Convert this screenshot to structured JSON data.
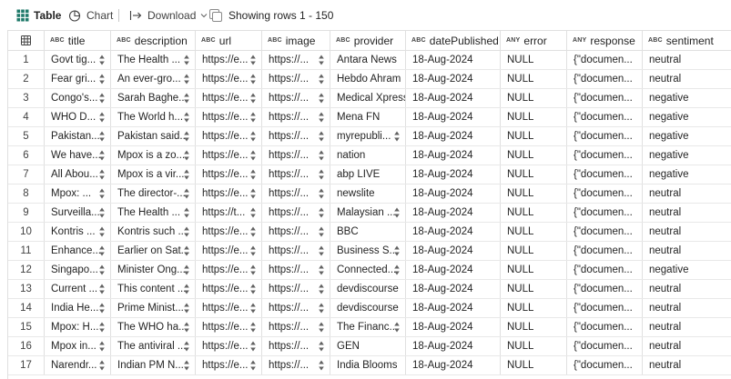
{
  "toolbar": {
    "table_label": "Table",
    "chart_label": "Chart",
    "download_label": "Download",
    "rows_label": "Showing rows 1 - 150"
  },
  "columns": [
    {
      "type": "ABC",
      "name": "title"
    },
    {
      "type": "ABC",
      "name": "description"
    },
    {
      "type": "ABC",
      "name": "url"
    },
    {
      "type": "ABC",
      "name": "image"
    },
    {
      "type": "ABC",
      "name": "provider"
    },
    {
      "type": "ABC",
      "name": "datePublished"
    },
    {
      "type": "ANY",
      "name": "error"
    },
    {
      "type": "ANY",
      "name": "response"
    },
    {
      "type": "ABC",
      "name": "sentiment"
    }
  ],
  "rows": [
    {
      "n": "1",
      "title": "Govt tig...",
      "description": "The Health ...",
      "url": "https://e...",
      "image": "https://...",
      "provider": "Antara News",
      "date": "18-Aug-2024",
      "error": "NULL",
      "response": "{\"documen...",
      "sentiment": "neutral"
    },
    {
      "n": "2",
      "title": "Fear gri...",
      "description": "An ever-gro...",
      "url": "https://e...",
      "image": "https://...",
      "provider": "Hebdo Ahram",
      "date": "18-Aug-2024",
      "error": "NULL",
      "response": "{\"documen...",
      "sentiment": "neutral"
    },
    {
      "n": "3",
      "title": "Congo's...",
      "description": "Sarah Baghe...",
      "url": "https://e...",
      "image": "https://...",
      "provider": "Medical Xpress",
      "date": "18-Aug-2024",
      "error": "NULL",
      "response": "{\"documen...",
      "sentiment": "negative"
    },
    {
      "n": "4",
      "title": "WHO D...",
      "description": "The World h...",
      "url": "https://e...",
      "image": "https://...",
      "provider": "Mena FN",
      "date": "18-Aug-2024",
      "error": "NULL",
      "response": "{\"documen...",
      "sentiment": "negative"
    },
    {
      "n": "5",
      "title": "Pakistan...",
      "description": "Pakistan said...",
      "url": "https://e...",
      "image": "https://...",
      "provider": "myrepubli...",
      "date": "18-Aug-2024",
      "error": "NULL",
      "response": "{\"documen...",
      "sentiment": "negative"
    },
    {
      "n": "6",
      "title": "We have...",
      "description": "Mpox is a zo...",
      "url": "https://e...",
      "image": "https://...",
      "provider": "nation",
      "date": "18-Aug-2024",
      "error": "NULL",
      "response": "{\"documen...",
      "sentiment": "negative"
    },
    {
      "n": "7",
      "title": "All Abou...",
      "description": "Mpox is a vir...",
      "url": "https://e...",
      "image": "https://...",
      "provider": "abp LIVE",
      "date": "18-Aug-2024",
      "error": "NULL",
      "response": "{\"documen...",
      "sentiment": "negative"
    },
    {
      "n": "8",
      "title": "Mpox: ...",
      "description": "The director-...",
      "url": "https://e...",
      "image": "https://...",
      "provider": "newslite",
      "date": "18-Aug-2024",
      "error": "NULL",
      "response": "{\"documen...",
      "sentiment": "neutral"
    },
    {
      "n": "9",
      "title": "Surveilla...",
      "description": "The Health ...",
      "url": "https://t...",
      "image": "https://...",
      "provider": "Malaysian ...",
      "date": "18-Aug-2024",
      "error": "NULL",
      "response": "{\"documen...",
      "sentiment": "neutral"
    },
    {
      "n": "10",
      "title": "Kontris ...",
      "description": "Kontris such ...",
      "url": "https://e...",
      "image": "https://...",
      "provider": "BBC",
      "date": "18-Aug-2024",
      "error": "NULL",
      "response": "{\"documen...",
      "sentiment": "neutral"
    },
    {
      "n": "11",
      "title": "Enhance...",
      "description": "Earlier on Sat...",
      "url": "https://e...",
      "image": "https://...",
      "provider": "Business S...",
      "date": "18-Aug-2024",
      "error": "NULL",
      "response": "{\"documen...",
      "sentiment": "neutral"
    },
    {
      "n": "12",
      "title": "Singapo...",
      "description": "Minister Ong...",
      "url": "https://e...",
      "image": "https://...",
      "provider": "Connected...",
      "date": "18-Aug-2024",
      "error": "NULL",
      "response": "{\"documen...",
      "sentiment": "negative"
    },
    {
      "n": "13",
      "title": "Current ...",
      "description": "This content ...",
      "url": "https://e...",
      "image": "https://...",
      "provider": "devdiscourse",
      "date": "18-Aug-2024",
      "error": "NULL",
      "response": "{\"documen...",
      "sentiment": "neutral"
    },
    {
      "n": "14",
      "title": "India He...",
      "description": "Prime Minist...",
      "url": "https://e...",
      "image": "https://...",
      "provider": "devdiscourse",
      "date": "18-Aug-2024",
      "error": "NULL",
      "response": "{\"documen...",
      "sentiment": "neutral"
    },
    {
      "n": "15",
      "title": "Mpox: H...",
      "description": "The WHO ha...",
      "url": "https://e...",
      "image": "https://...",
      "provider": "The Financ...",
      "date": "18-Aug-2024",
      "error": "NULL",
      "response": "{\"documen...",
      "sentiment": "neutral"
    },
    {
      "n": "16",
      "title": "Mpox in...",
      "description": "The antiviral ...",
      "url": "https://e...",
      "image": "https://...",
      "provider": "GEN",
      "date": "18-Aug-2024",
      "error": "NULL",
      "response": "{\"documen...",
      "sentiment": "neutral"
    },
    {
      "n": "17",
      "title": "Narendr...",
      "description": "Indian PM N...",
      "url": "https://e...",
      "image": "https://...",
      "provider": "India Blooms",
      "date": "18-Aug-2024",
      "error": "NULL",
      "response": "{\"documen...",
      "sentiment": "neutral"
    }
  ],
  "sort_cols": {
    "1": [
      "title",
      "description",
      "url",
      "image"
    ],
    "2": [
      "title",
      "description",
      "url",
      "image"
    ],
    "3": [
      "title",
      "description",
      "url",
      "image"
    ],
    "4": [
      "title",
      "description",
      "url",
      "image"
    ],
    "5": [
      "title",
      "description",
      "url",
      "image",
      "provider"
    ],
    "6": [
      "title",
      "description",
      "url",
      "image"
    ],
    "7": [
      "title",
      "description",
      "url",
      "image"
    ],
    "8": [
      "title",
      "description",
      "url",
      "image"
    ],
    "9": [
      "title",
      "description",
      "url",
      "image",
      "provider"
    ],
    "10": [
      "title",
      "description",
      "url",
      "image"
    ],
    "11": [
      "title",
      "description",
      "url",
      "image",
      "provider"
    ],
    "12": [
      "title",
      "description",
      "url",
      "image",
      "provider"
    ],
    "13": [
      "title",
      "description",
      "url",
      "image"
    ],
    "14": [
      "title",
      "description",
      "url",
      "image"
    ],
    "15": [
      "title",
      "description",
      "url",
      "image",
      "provider"
    ],
    "16": [
      "title",
      "description",
      "url",
      "image"
    ],
    "17": [
      "title",
      "description",
      "url",
      "image"
    ]
  },
  "colors": {
    "accent": "#1f7a6a",
    "border": "#e0e0e0"
  },
  "icons": {
    "table": "table-grid-icon",
    "chart": "chart-pie-icon",
    "download": "download-arrow-icon",
    "rows": "rows-stack-icon"
  }
}
